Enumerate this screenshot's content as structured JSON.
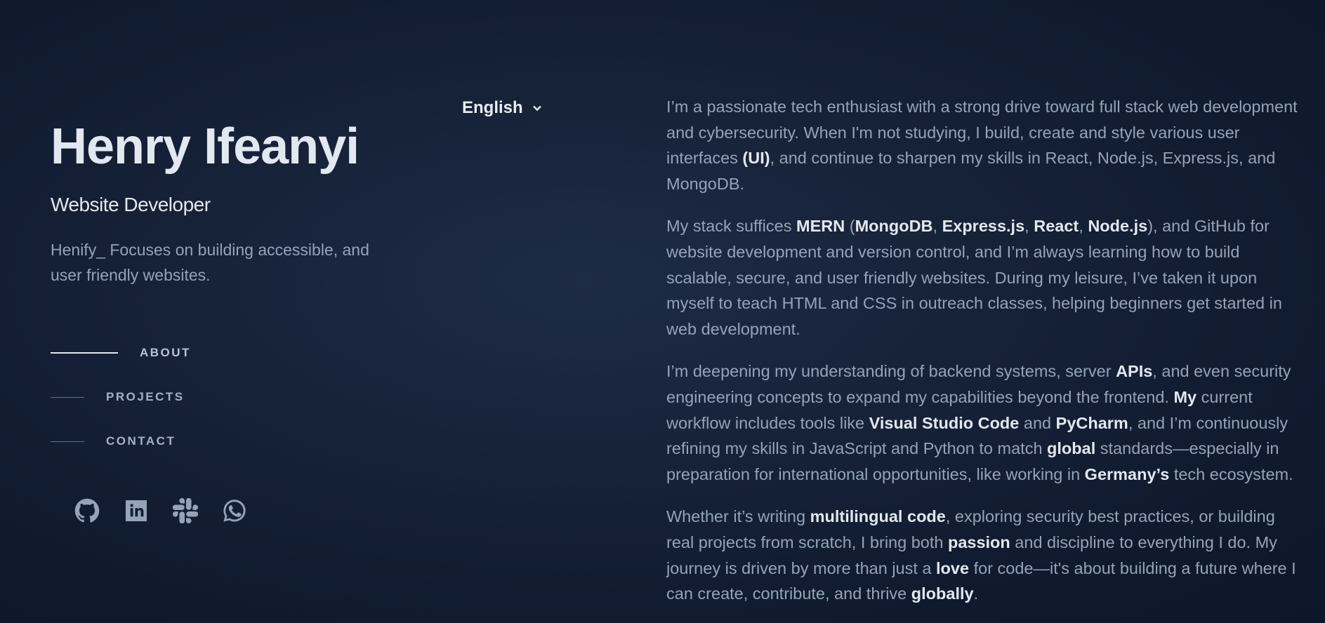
{
  "profile": {
    "name": "Henry Ifeanyi",
    "role": "Website Developer",
    "tagline": "Henify_ Focuses on building accessible, and user friendly websites."
  },
  "nav": {
    "items": [
      {
        "label": "ABOUT",
        "active": true
      },
      {
        "label": "PROJECTS",
        "active": false
      },
      {
        "label": "CONTACT",
        "active": false
      }
    ]
  },
  "social": {
    "icons": [
      "github-icon",
      "linkedin-icon",
      "slack-icon",
      "whatsapp-icon"
    ]
  },
  "language": {
    "selected": "English"
  },
  "about": {
    "p1": [
      {
        "t": "I’m a passionate tech enthusiast with a strong drive toward full stack web development and cybersecurity. When I'm not studying, I build, create and style various user interfaces "
      },
      {
        "t": "(UI)",
        "b": true
      },
      {
        "t": ", and continue to sharpen my skills in React, Node.js, Express.js, and MongoDB."
      }
    ],
    "p2": [
      {
        "t": "My stack suffices "
      },
      {
        "t": "MERN",
        "b": true
      },
      {
        "t": " ("
      },
      {
        "t": "MongoDB",
        "b": true
      },
      {
        "t": ", "
      },
      {
        "t": "Express.js",
        "b": true
      },
      {
        "t": ", "
      },
      {
        "t": "React",
        "b": true
      },
      {
        "t": ", "
      },
      {
        "t": "Node.js",
        "b": true
      },
      {
        "t": "), and GitHub for website development and version control, and I’m always learning how to build scalable, secure, and user friendly websites. During my leisure, I’ve taken it upon myself to teach HTML and CSS in outreach classes, helping beginners get started in web development."
      }
    ],
    "p3": [
      {
        "t": "I’m deepening my understanding of backend systems, server "
      },
      {
        "t": "APIs",
        "b": true
      },
      {
        "t": ", and even security engineering concepts to expand my capabilities beyond the frontend. "
      },
      {
        "t": "My",
        "b": true
      },
      {
        "t": " current workflow includes tools like "
      },
      {
        "t": "Visual Studio Code",
        "b": true
      },
      {
        "t": " and "
      },
      {
        "t": "PyCharm",
        "b": true
      },
      {
        "t": ", and I’m continuously refining my skills in JavaScript and Python to match "
      },
      {
        "t": "global",
        "b": true
      },
      {
        "t": " standards—especially in preparation for international opportunities, like working in "
      },
      {
        "t": "Germany’s",
        "b": true
      },
      {
        "t": " tech ecosystem."
      }
    ],
    "p4": [
      {
        "t": "Whether it’s writing "
      },
      {
        "t": "multilingual code",
        "b": true
      },
      {
        "t": ", exploring security best practices, or building real projects from scratch, I bring both "
      },
      {
        "t": "passion",
        "b": true
      },
      {
        "t": " and discipline to everything I do. My journey is driven by more than just a "
      },
      {
        "t": "love",
        "b": true
      },
      {
        "t": " for code—it's about building a future where I can create, contribute, and thrive "
      },
      {
        "t": "globally",
        "b": true
      },
      {
        "t": "."
      }
    ]
  }
}
